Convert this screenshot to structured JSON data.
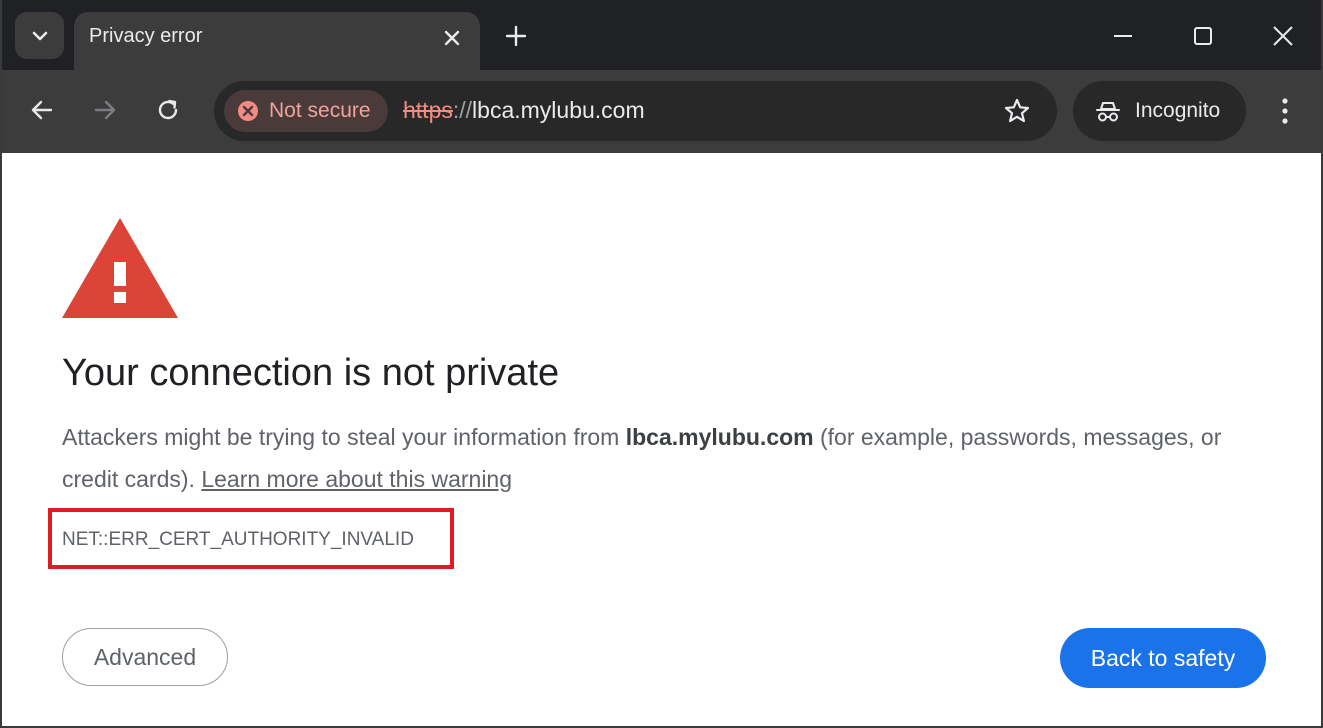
{
  "tab": {
    "title": "Privacy error"
  },
  "toolbar": {
    "security_chip_label": "Not secure",
    "url_scheme": "https",
    "url_separator": "://",
    "url_host": "lbca.mylubu.com",
    "incognito_label": "Incognito"
  },
  "page": {
    "heading": "Your connection is not private",
    "body_prefix": "Attackers might be trying to steal your information from ",
    "body_host": "lbca.mylubu.com",
    "body_suffix": " (for example, passwords, messages, or credit cards). ",
    "learn_more_link": "Learn more about this warning",
    "error_code": "NET::ERR_CERT_AUTHORITY_INVALID",
    "advanced_button": "Advanced",
    "back_button": "Back to safety"
  },
  "colors": {
    "tab_strip_bg": "#202124",
    "toolbar_bg": "#3c3c3c",
    "warning_red": "#db4437",
    "not_secure_text": "#f2a29a",
    "highlight_box": "#e21b23",
    "primary_button": "#1a73e8"
  },
  "icons": {
    "tab_search": "chevron-down-icon",
    "tab_close": "close-icon",
    "new_tab": "plus-icon",
    "minimize": "minimize-icon",
    "maximize": "maximize-icon",
    "window_close": "close-icon",
    "back": "arrow-left-icon",
    "forward": "arrow-right-icon",
    "reload": "reload-icon",
    "not_secure": "error-circle-icon",
    "bookmark": "star-icon",
    "incognito": "incognito-icon",
    "menu": "kebab-menu-icon",
    "warning": "warning-triangle-icon"
  }
}
